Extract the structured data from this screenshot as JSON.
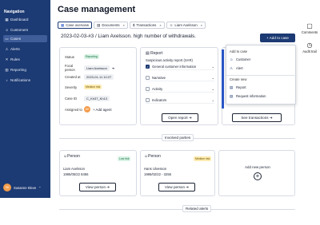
{
  "sidebar": {
    "title": "Navigation",
    "items": [
      {
        "label": "Dashboard",
        "icon": "grid-icon",
        "glyph": "▦"
      },
      {
        "label": "Customers",
        "icon": "users-icon",
        "glyph": "☺"
      },
      {
        "label": "Cases",
        "icon": "folder-icon",
        "glyph": "▭"
      },
      {
        "label": "Alerts",
        "icon": "alert-icon",
        "glyph": "⚠"
      },
      {
        "label": "Rules",
        "icon": "rules-icon",
        "glyph": "✕"
      },
      {
        "label": "Reporting",
        "icon": "chart-icon",
        "glyph": "▥"
      },
      {
        "label": "Notifications",
        "icon": "bell-icon",
        "glyph": "♪"
      }
    ],
    "user": {
      "initials": "SK",
      "name": "Susanne Kleve",
      "chevron": "⌃"
    }
  },
  "header": {
    "title": "Case management",
    "tabs": [
      {
        "label": "Case overview",
        "glyph": "▦"
      },
      {
        "label": "Documents",
        "glyph": "▤"
      },
      {
        "label": "Transactions",
        "glyph": "$"
      },
      {
        "label": "Liam Axelsson",
        "glyph": "☺"
      }
    ],
    "tab_close": "×",
    "case_heading": "2023-02-03-#3 / Liam Axelsson. high number of withdrawals.",
    "add_to_case": "+ Add to case"
  },
  "side_tools": {
    "comments": {
      "label": "Comments",
      "glyph": "▢"
    },
    "audit": {
      "label": "Audit trail",
      "glyph": "◷"
    }
  },
  "case_info": {
    "status_label": "Status",
    "status_value": "Reporting",
    "focal_label": "Focal person",
    "focal_value": "Liam Axelsson",
    "created_label": "Created at",
    "created_value": "2023-01-11 10:27",
    "severity_label": "Severity",
    "severity_value": "Medium risk",
    "caseid_label": "Case ID",
    "caseid_value": "C_Kh37_Kh13",
    "assigned_label": "Assigned to",
    "assigned_initials": "DK",
    "add_agent": "+ Add agent",
    "arrow": "➔"
  },
  "report": {
    "title": "Report",
    "subtitle": "Suspicious activity report (SAR)",
    "items": [
      {
        "label": "General customer information",
        "checked": true
      },
      {
        "label": "Narrative",
        "checked": false
      },
      {
        "label": "Activity",
        "checked": false
      },
      {
        "label": "Indicators",
        "checked": false
      }
    ],
    "open_report": "Open report ➔"
  },
  "transactions": {
    "button": "See transactions ➔"
  },
  "involved_parties": {
    "label": "Involved parties",
    "persons": [
      {
        "title": "Person",
        "risk": "Low risk",
        "name": "Liam Axelsson",
        "dob": "1985/05/22 8456",
        "button": "View person ➔"
      },
      {
        "title": "Person",
        "risk": "Medium risk",
        "name": "Hans Ulvesson",
        "dob": "1986/02/22 - 3256",
        "button": "View person ➔"
      }
    ],
    "add_person": "Add new person"
  },
  "related_alerts": {
    "label": "Related alerts"
  },
  "dropdown": {
    "add_to_case": "Add to case",
    "case_items": [
      {
        "label": "Customer",
        "glyph": "☺"
      },
      {
        "label": "Alert",
        "glyph": "⚠"
      }
    ],
    "create_new": "Create new",
    "create_items": [
      {
        "label": "Report",
        "glyph": "▤"
      },
      {
        "label": "Request information",
        "glyph": "▤"
      }
    ]
  },
  "colors": {
    "brand": "#1c3a73",
    "accent": "#2a57c8",
    "low_risk": "#d6f2e4",
    "medium_risk": "#fcebb0",
    "avatar": "#f39c4a"
  }
}
